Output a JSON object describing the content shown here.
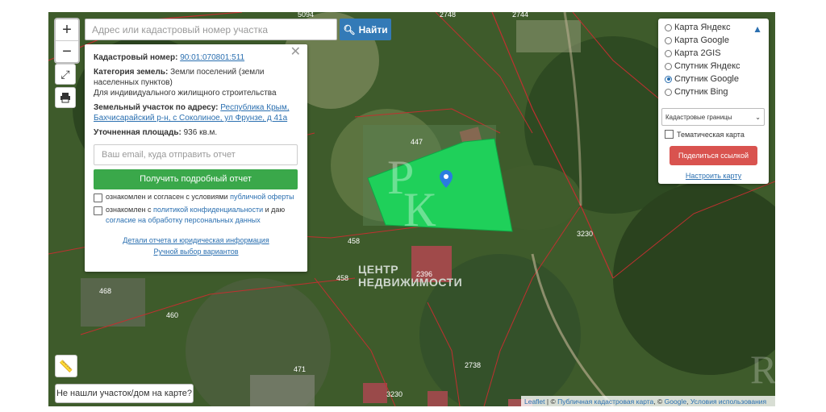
{
  "search": {
    "placeholder": "Адрес или кадастровый номер участка",
    "button_label": "Найти"
  },
  "zoom": {
    "in": "+",
    "out": "−"
  },
  "popup": {
    "cadastral_label": "Кадастровый номер:",
    "cadastral_value": "90:01:070801:511",
    "category_label": "Категория земель:",
    "category_value": "Земли поселений (земли населенных пунктов)",
    "usage_value": "Для индивидуального жилищного строительства",
    "address_label": "Земельный участок по адресу:",
    "address_value": "Республика Крым, Бахчисарайский р-н, с Соколиное, ул Фрунзе, д 41а",
    "area_label": "Уточненная площадь:",
    "area_value": "936 кв.м.",
    "email_placeholder": "Ваш email, куда отправить отчет",
    "report_button": "Получить подробный отчет",
    "consent1_prefix": "ознакомлен и согласен с условиями",
    "consent1_link": "публичной оферты",
    "consent2_prefix": "ознакомлен с",
    "consent2_link1": "политикой конфиденциальности",
    "consent2_mid": "и даю",
    "consent2_link2": "согласие на обработку персональных данных",
    "details_link": "Детали отчета и юридическая информация",
    "manual_link": "Ручной выбор вариантов"
  },
  "layers": {
    "options": [
      "Карта Яндекс",
      "Карта Google",
      "Карта 2GIS",
      "Спутник Яндекс",
      "Спутник Google",
      "Спутник Bing"
    ],
    "selected": "Спутник Google",
    "select_value": "Кадастровые границы",
    "thematic_label": "Тематическая карта",
    "share_button": "Поделиться ссылкой",
    "configure_link": "Настроить карту"
  },
  "map_labels": [
    "447",
    "458",
    "458",
    "468",
    "460",
    "471",
    "3230",
    "3230",
    "2396",
    "2738",
    "2744",
    "5094",
    "2748"
  ],
  "watermark": {
    "line1": "ЦЕНТР",
    "line2": "НЕДВИЖИМОСТИ",
    "logo": "РК"
  },
  "not_found_button": "Не нашли участок/дом на карте?",
  "attribution": {
    "leaflet": "Leaflet",
    "pkk": "Публичная кадастровая карта",
    "google": "Google",
    "terms": "Условия использования"
  },
  "colors": {
    "primary": "#337ab7",
    "success": "#3aa84a",
    "danger": "#d9534f",
    "parcel": "#1fd05a"
  }
}
